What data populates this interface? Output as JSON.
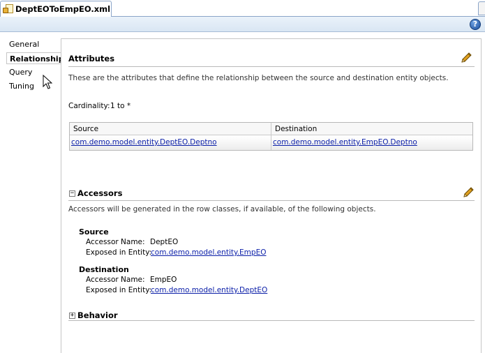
{
  "editor_tab": {
    "label": "DeptEOToEmpEO.xml"
  },
  "help": {
    "glyph": "?"
  },
  "nav": {
    "items": [
      {
        "label": "General"
      },
      {
        "label": "Relationship"
      },
      {
        "label": "Query"
      },
      {
        "label": "Tuning"
      }
    ]
  },
  "attributes": {
    "title": "Attributes",
    "description": "These are the attributes that define the relationship between the source and destination entity objects.",
    "cardinality_label": "Cardinality:",
    "cardinality_value": "1 to *",
    "table": {
      "columns": [
        "Source",
        "Destination"
      ],
      "rows": [
        [
          "com.demo.model.entity.DeptEO.Deptno",
          "com.demo.model.entity.EmpEO.Deptno"
        ]
      ]
    }
  },
  "accessors": {
    "toggle": "−",
    "title": "Accessors",
    "description": "Accessors will be generated in the row classes, if available, of the following objects.",
    "source": {
      "heading": "Source",
      "accessor_label": "Accessor Name:",
      "accessor_value": "DeptEO",
      "exposed_label": "Exposed in Entity:",
      "exposed_value": "com.demo.model.entity.EmpEO"
    },
    "destination": {
      "heading": "Destination",
      "accessor_label": "Accessor Name:",
      "accessor_value": "EmpEO",
      "exposed_label": "Exposed in Entity:",
      "exposed_value": "com.demo.model.entity.DeptEO"
    }
  },
  "behavior": {
    "toggle": "+",
    "title": "Behavior"
  },
  "colors": {
    "link": "#0a1ea8",
    "pencil": "#e0a020",
    "help": "#1d4f9c"
  }
}
